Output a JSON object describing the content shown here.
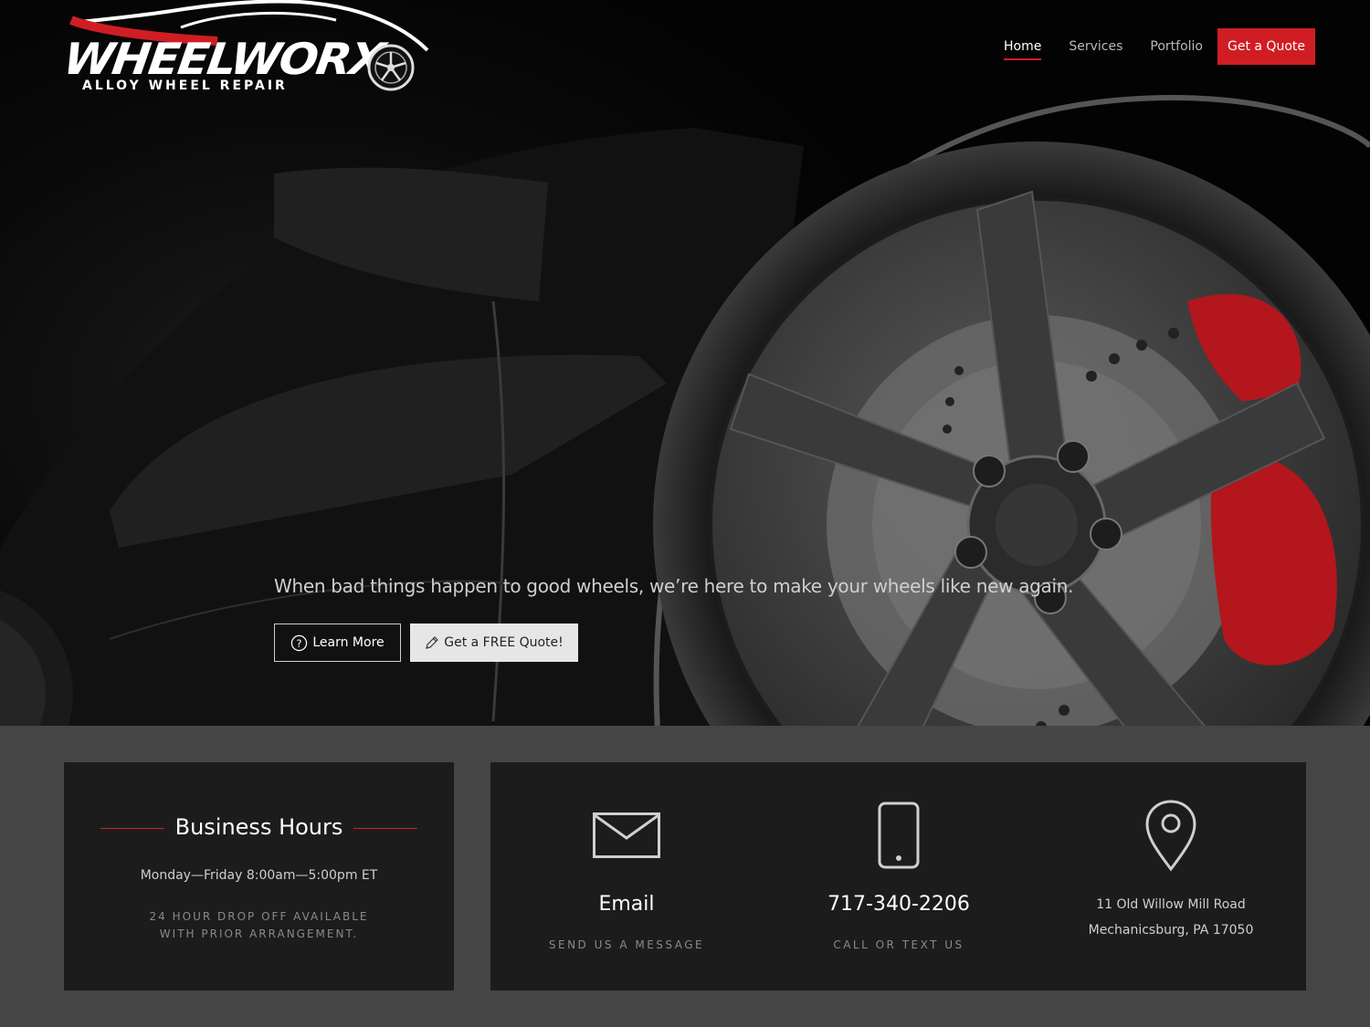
{
  "brand": {
    "name": "WHEELWORX",
    "tagline": "ALLOY WHEEL REPAIR",
    "accent_color": "#d01d24"
  },
  "nav": {
    "items": [
      {
        "label": "Home",
        "active": true
      },
      {
        "label": "Services",
        "active": false
      },
      {
        "label": "Portfolio",
        "active": false
      }
    ],
    "cta_label": "Get a Quote"
  },
  "hero": {
    "tagline": "When bad things happen to good wheels, we’re here to make your wheels like new again.",
    "learn_more_label": "Learn More",
    "learn_more_icon": "question-circle-icon",
    "free_quote_label": "Get a FREE Quote!",
    "free_quote_icon": "pencil-icon"
  },
  "hours": {
    "title": "Business Hours",
    "schedule": "Monday—Friday 8:00am—5:00pm ET",
    "note_line1": "24 HOUR DROP OFF AVAILABLE",
    "note_line2": "WITH PRIOR ARRANGEMENT."
  },
  "contact": {
    "email": {
      "title": "Email",
      "subtitle": "SEND US A MESSAGE",
      "icon": "envelope-icon"
    },
    "phone": {
      "title": "717-340-2206",
      "subtitle": "CALL OR TEXT US",
      "icon": "smartphone-icon"
    },
    "location": {
      "line1": "11 Old Willow Mill Road",
      "line2": "Mechanicsburg, PA 17050",
      "icon": "map-pin-icon"
    }
  }
}
